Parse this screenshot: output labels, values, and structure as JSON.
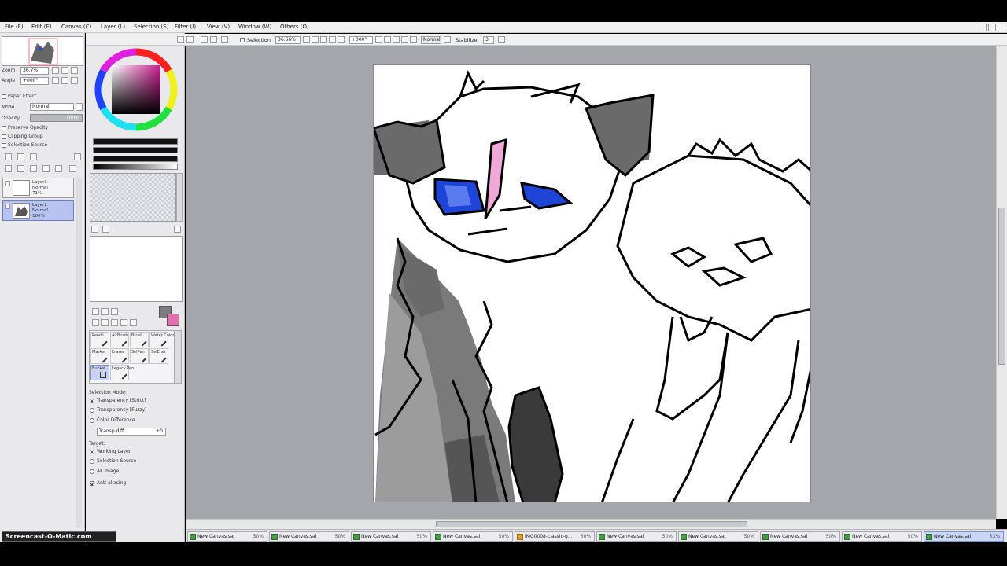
{
  "menu": [
    "File (F)",
    "Edit (E)",
    "Canvas (C)",
    "Layer (L)",
    "Selection (S)",
    "Filter (I)",
    "View (V)",
    "Window (W)",
    "Others (O)"
  ],
  "toolbar": {
    "selection_label": "Selection",
    "zoom_value": "36.66%",
    "rotate_value": "+000°",
    "mode_value": "Normal",
    "stabilizer_label": "Stabilizer",
    "stabilizer_value": "3"
  },
  "navigator": {
    "zoom_label": "Zoom",
    "zoom_value": "36.7%",
    "angle_label": "Angle",
    "angle_value": "+000°"
  },
  "layer_props": {
    "paper_effect_label": "Paper Effect",
    "mode_label": "Mode",
    "mode_value": "Normal",
    "opacity_label": "Opacity",
    "opacity_value": "100%",
    "preserve_opacity_label": "Preserve Opacity",
    "clipping_group_label": "Clipping Group",
    "selection_source_label": "Selection Source"
  },
  "layers": [
    {
      "name": "Layer3",
      "mode": "Normal",
      "opacity": "71%",
      "selected": false
    },
    {
      "name": "Layer2",
      "mode": "Normal",
      "opacity": "100%",
      "selected": true
    }
  ],
  "tools": [
    [
      "Pencil",
      "AirBrush",
      "Brush",
      "Water Color"
    ],
    [
      "Marker",
      "Eraser",
      "SelPen",
      "SelEras"
    ],
    [
      "Bucket",
      "Legacy Pen"
    ]
  ],
  "tool_options": {
    "selection_mode_label": "Selection Mode:",
    "modes": [
      "Transparency [Strict]",
      "Transparency [Fuzzy]",
      "Color Difference"
    ],
    "selected_mode": 0,
    "antialias_dropdown": "Transp.diff",
    "antialias_value": "±0",
    "target_label": "Target:",
    "targets": [
      "Working Layer",
      "Selection Source",
      "All Image"
    ],
    "selected_target": 0,
    "anti_aliasing_label": "Anti-aliasing"
  },
  "doc_tabs": [
    {
      "name": "New Canvas.sai",
      "pct": "50%",
      "active": false
    },
    {
      "name": "New Canvas.sai",
      "pct": "50%",
      "active": false
    },
    {
      "name": "New Canvas.sai",
      "pct": "50%",
      "active": false
    },
    {
      "name": "New Canvas.sai",
      "pct": "50%",
      "active": false
    },
    {
      "name": "IMG0008-classic-g...",
      "pct": "50%",
      "active": false
    },
    {
      "name": "New Canvas.sai",
      "pct": "50%",
      "active": false
    },
    {
      "name": "New Canvas.sai",
      "pct": "50%",
      "active": false
    },
    {
      "name": "New Canvas.sai",
      "pct": "50%",
      "active": false
    },
    {
      "name": "New Canvas.sai",
      "pct": "50%",
      "active": false
    },
    {
      "name": "New Canvas.sai",
      "pct": "33%",
      "active": true
    }
  ],
  "colors": {
    "primary": "#7c7c7c",
    "secondary": "#e070b0",
    "eye_blue": "#1e44d8",
    "scar_pink": "#f0a8d8"
  },
  "watermark": "Screencast-O-Matic.com"
}
